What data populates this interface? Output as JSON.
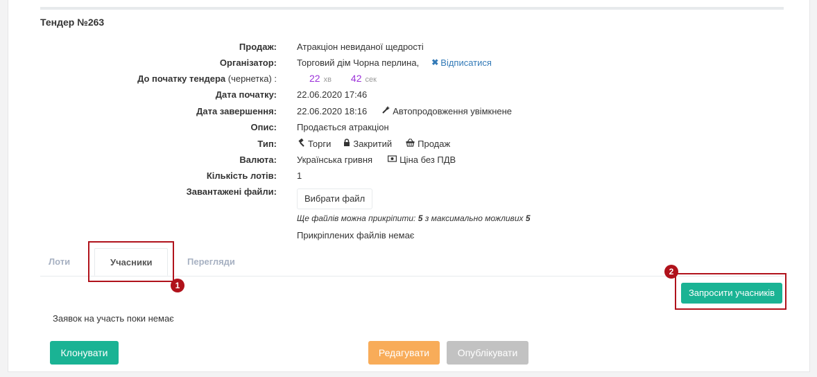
{
  "tender": {
    "title": "Тендер №263",
    "fields": {
      "sale_label": "Продаж:",
      "sale_value": "Атракціон невиданої щедрості",
      "organizer_label": "Організатор:",
      "organizer_value": "Торговий дім Чорна перлина,",
      "unsubscribe_label": "Відписатися",
      "start_countdown_label": "До початку тендера",
      "start_countdown_note": "(чернетка) :",
      "minutes_value": "22",
      "minutes_unit": "хв",
      "seconds_value": "42",
      "seconds_unit": "сек",
      "start_date_label": "Дата початку:",
      "start_date_value": "22.06.2020 17:46",
      "end_date_label": "Дата завершення:",
      "end_date_value": "22.06.2020 18:16",
      "autoextend_label": "Автопродовження увімкнене",
      "description_label": "Опис:",
      "description_value": "Продається атракціон",
      "type_label": "Тип:",
      "type_auction": "Торги",
      "type_closed": "Закритий",
      "type_sale": "Продаж",
      "currency_label": "Валюта:",
      "currency_value": "Українська гривня",
      "vat_label": "Ціна без ПДВ",
      "lots_label": "Кількість лотів:",
      "lots_value": "1",
      "files_label": "Завантажені файли:",
      "choose_file_label": "Вибрати файл",
      "files_hint_prefix": "Ще файлів можна прикріпити:",
      "files_hint_count": "5",
      "files_hint_middle": "з максимально можливих",
      "files_hint_max": "5",
      "no_files_text": "Прикріплених файлів немає"
    }
  },
  "tabs": {
    "lots": "Лоти",
    "participants": "Учасники",
    "views": "Перегляди"
  },
  "participants": {
    "invite_button": "Запросити учасників",
    "no_applications": "Заявок на участь поки немає"
  },
  "badges": {
    "first": "1",
    "second": "2"
  },
  "actions": {
    "clone": "Клонувати",
    "edit": "Редагувати",
    "publish": "Опублікувати"
  },
  "colors": {
    "accent_green": "#1ab394",
    "orange": "#f8ac59",
    "timer_purple": "#9b30d9",
    "highlight_red": "#b0121b",
    "link_blue": "#337ab7"
  },
  "icons": [
    "times-icon",
    "magic-wand-icon",
    "gavel-icon",
    "lock-icon",
    "basket-icon",
    "money-icon"
  ]
}
